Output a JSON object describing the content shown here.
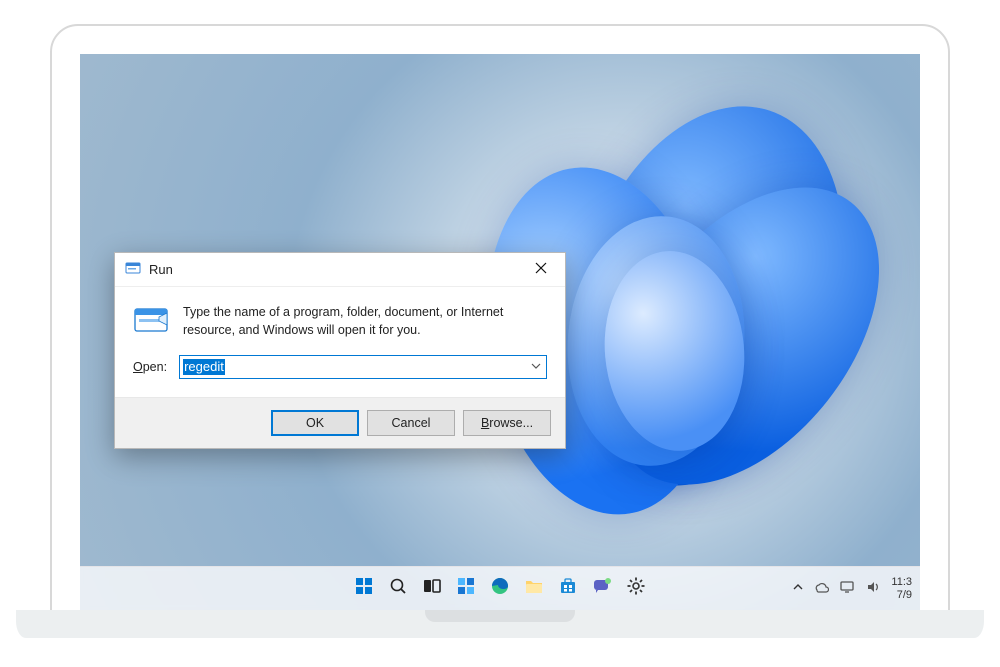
{
  "run_dialog": {
    "title": "Run",
    "description": "Type the name of a program, folder, document, or Internet resource, and Windows will open it for you.",
    "open_label_underline": "O",
    "open_label_rest": "pen:",
    "input_value": "regedit",
    "buttons": {
      "ok": "OK",
      "cancel": "Cancel",
      "browse_underline": "B",
      "browse_rest": "rowse..."
    }
  },
  "taskbar": {
    "icons": [
      "start",
      "search",
      "task-view",
      "widgets",
      "edge",
      "explorer",
      "store",
      "teams",
      "settings"
    ]
  },
  "tray": {
    "chevron": "^",
    "time": "11:3",
    "date": "7/9"
  }
}
